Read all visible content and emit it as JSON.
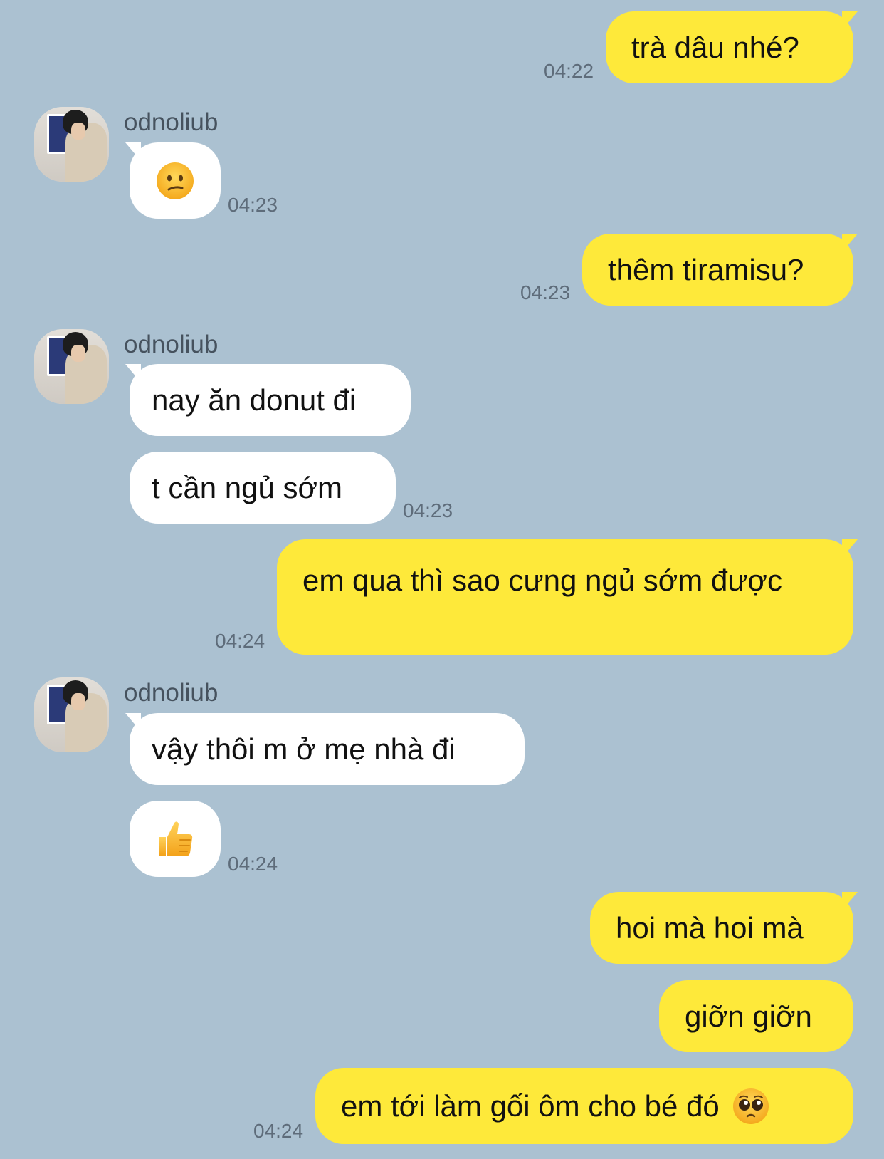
{
  "contact": {
    "name": "odnoliub"
  },
  "messages": [
    {
      "id": "m1",
      "direction": "out",
      "text": "trà dâu nhé?",
      "time": "04:22"
    },
    {
      "id": "m2",
      "direction": "in",
      "emoji": "confused-face",
      "time": "04:23"
    },
    {
      "id": "m3",
      "direction": "out",
      "text": "thêm tiramisu?",
      "time": "04:23"
    },
    {
      "id": "m4",
      "direction": "in",
      "text": "nay ăn donut đi"
    },
    {
      "id": "m5",
      "direction": "in",
      "text": "t cần ngủ sớm",
      "time": "04:23"
    },
    {
      "id": "m6",
      "direction": "out",
      "text": "em qua thì sao cưng ngủ sớm được",
      "time": "04:24"
    },
    {
      "id": "m7",
      "direction": "in",
      "text": "vậy thôi m ở mẹ nhà đi"
    },
    {
      "id": "m8",
      "direction": "in",
      "emoji": "thumbs-up",
      "time": "04:24"
    },
    {
      "id": "m9",
      "direction": "out",
      "text": "hoi mà hoi mà"
    },
    {
      "id": "m10",
      "direction": "out",
      "text": "giỡn giỡn"
    },
    {
      "id": "m11",
      "direction": "out",
      "text": "em tới làm gối ôm cho bé đó",
      "emoji": "pleading-face",
      "time": "04:24"
    }
  ],
  "colors": {
    "background": "#abc1d1",
    "outgoing_bubble": "#fee93a",
    "incoming_bubble": "#ffffff",
    "timestamp": "#5e6c7a",
    "sender_name": "#46525e"
  }
}
